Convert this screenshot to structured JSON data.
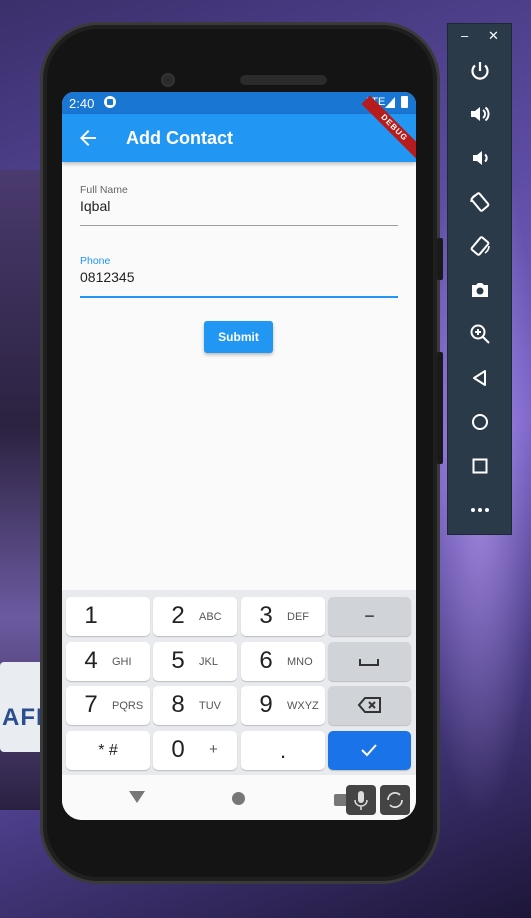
{
  "status_bar": {
    "time": "2:40",
    "network": "LTE",
    "debug_banner": "DEBUG"
  },
  "app_bar": {
    "title": "Add Contact"
  },
  "form": {
    "full_name": {
      "label": "Full Name",
      "value": "Iqbal"
    },
    "phone": {
      "label": "Phone",
      "value": "0812345"
    },
    "submit_label": "Submit"
  },
  "keyboard": {
    "rows": [
      [
        {
          "main": "1",
          "sub": ""
        },
        {
          "main": "2",
          "sub": "ABC"
        },
        {
          "main": "3",
          "sub": "DEF"
        },
        {
          "main": "−",
          "sub": "",
          "fn": true
        }
      ],
      [
        {
          "main": "4",
          "sub": "GHI"
        },
        {
          "main": "5",
          "sub": "JKL"
        },
        {
          "main": "6",
          "sub": "MNO"
        },
        {
          "main": "space",
          "sub": "",
          "fn": true
        }
      ],
      [
        {
          "main": "7",
          "sub": "PQRS"
        },
        {
          "main": "8",
          "sub": "TUV"
        },
        {
          "main": "9",
          "sub": "WXYZ"
        },
        {
          "main": "backspace",
          "sub": "",
          "fn": true
        }
      ],
      [
        {
          "main": "* #",
          "sub": ""
        },
        {
          "main": "0",
          "sub": "+"
        },
        {
          "main": ".",
          "sub": ""
        },
        {
          "main": "done",
          "sub": ""
        }
      ]
    ]
  },
  "toolbar": {
    "minimize": "–",
    "close": "✕"
  },
  "colors": {
    "primary": "#2196f3",
    "status": "#1976d2",
    "keyboard_done": "#1a73e8"
  },
  "license_plate": "AFE"
}
